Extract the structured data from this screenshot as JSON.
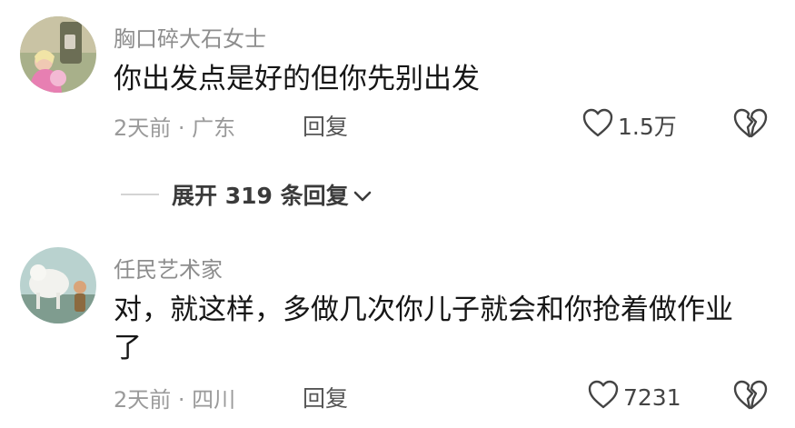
{
  "comments": [
    {
      "username": "胸口碎大石女士",
      "text": "你出发点是好的但你先别出发",
      "time_location": "2天前 · 广东",
      "reply_label": "回复",
      "likes": "1.5万"
    },
    {
      "username": "任民艺术家",
      "text": "对，就这样，多做几次你儿子就会和你抢着做作业了",
      "time_location": "2天前 · 四川",
      "reply_label": "回复",
      "likes": "7231"
    }
  ],
  "expand_replies": {
    "label": "展开 319 条回复"
  },
  "icons": {
    "like": "heart-outline-icon",
    "dislike": "broken-heart-icon",
    "expand": "chevron-down-icon"
  }
}
